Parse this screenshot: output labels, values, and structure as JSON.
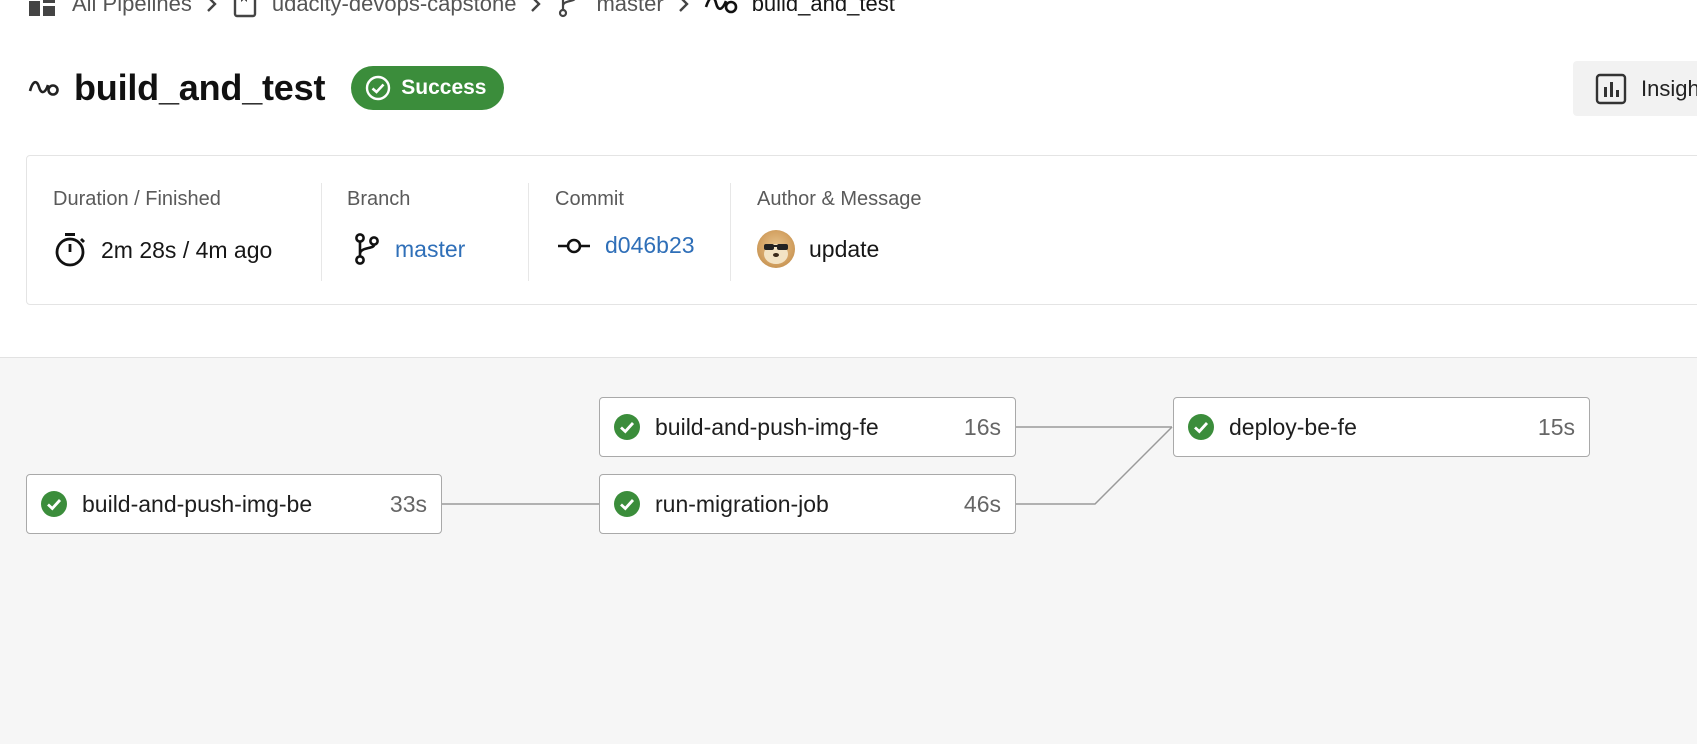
{
  "breadcrumb": {
    "items": [
      {
        "label": "All Pipelines",
        "icon": "dashboard-grid-icon"
      },
      {
        "label": "udacity-devops-capstone",
        "icon": "bookmark-icon"
      },
      {
        "label": "master",
        "icon": "branch-icon"
      },
      {
        "label": "build_and_test",
        "icon": "workflow-icon"
      }
    ]
  },
  "header": {
    "title": "build_and_test",
    "status": "Success",
    "insights_label": "Insights"
  },
  "summary": {
    "duration_label": "Duration / Finished",
    "duration_value": "2m 28s / 4m ago",
    "branch_label": "Branch",
    "branch_value": "master",
    "commit_label": "Commit",
    "commit_value": "d046b23",
    "author_label": "Author & Message",
    "message_value": "update"
  },
  "pipeline": {
    "jobs": [
      {
        "name": "build-and-push-img-be",
        "duration": "33s",
        "status": "success"
      },
      {
        "name": "build-and-push-img-fe",
        "duration": "16s",
        "status": "success"
      },
      {
        "name": "run-migration-job",
        "duration": "46s",
        "status": "success"
      },
      {
        "name": "deploy-be-fe",
        "duration": "15s",
        "status": "success"
      }
    ]
  },
  "colors": {
    "success": "#3b8d3b",
    "link": "#2f6fb8",
    "graph_background": "#f6f6f6"
  }
}
